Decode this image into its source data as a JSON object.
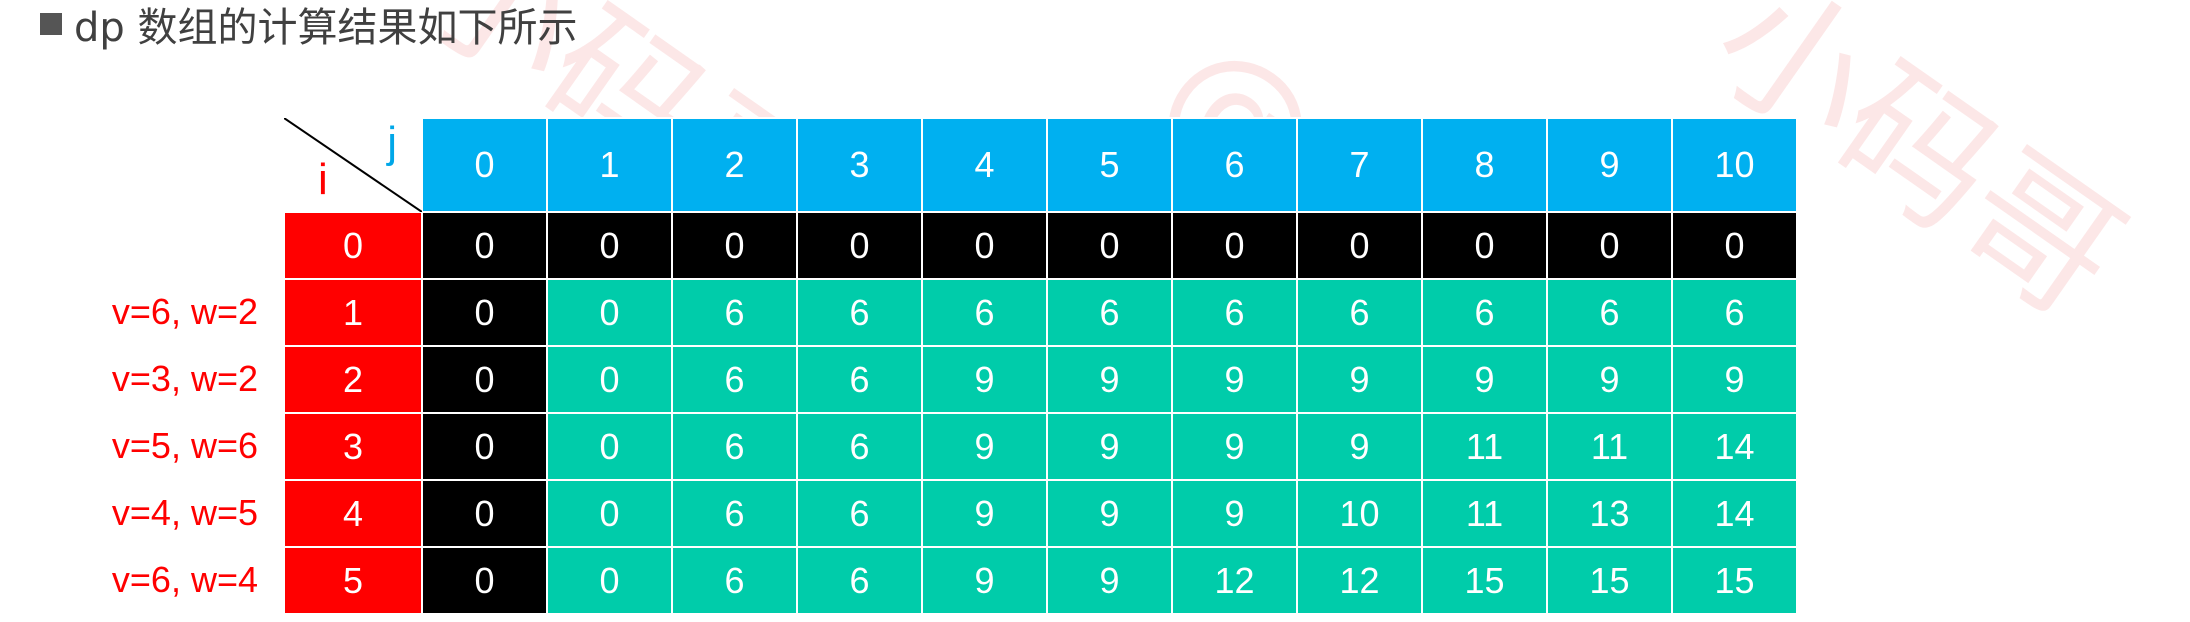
{
  "title": "dp 数组的计算结果如下所示",
  "colors": {
    "header_blue": "#00b0f0",
    "black": "#000000",
    "red": "#ff0000",
    "teal": "#00ccaa"
  },
  "table": {
    "corner_j": "j",
    "corner_i": "i",
    "col_headers": [
      "0",
      "1",
      "2",
      "3",
      "4",
      "5",
      "6",
      "7",
      "8",
      "9",
      "10"
    ],
    "rows": [
      {
        "label": "",
        "i": "0",
        "values": [
          "0",
          "0",
          "0",
          "0",
          "0",
          "0",
          "0",
          "0",
          "0",
          "0",
          "0"
        ]
      },
      {
        "label": "v=6, w=2",
        "i": "1",
        "values": [
          "0",
          "0",
          "6",
          "6",
          "6",
          "6",
          "6",
          "6",
          "6",
          "6",
          "6"
        ]
      },
      {
        "label": "v=3, w=2",
        "i": "2",
        "values": [
          "0",
          "0",
          "6",
          "6",
          "9",
          "9",
          "9",
          "9",
          "9",
          "9",
          "9"
        ]
      },
      {
        "label": "v=5, w=6",
        "i": "3",
        "values": [
          "0",
          "0",
          "6",
          "6",
          "9",
          "9",
          "9",
          "9",
          "11",
          "11",
          "14"
        ]
      },
      {
        "label": "v=4, w=5",
        "i": "4",
        "values": [
          "0",
          "0",
          "6",
          "6",
          "9",
          "9",
          "9",
          "10",
          "11",
          "13",
          "14"
        ]
      },
      {
        "label": "v=6, w=4",
        "i": "5",
        "values": [
          "0",
          "0",
          "6",
          "6",
          "9",
          "9",
          "12",
          "12",
          "15",
          "15",
          "15"
        ]
      }
    ]
  }
}
